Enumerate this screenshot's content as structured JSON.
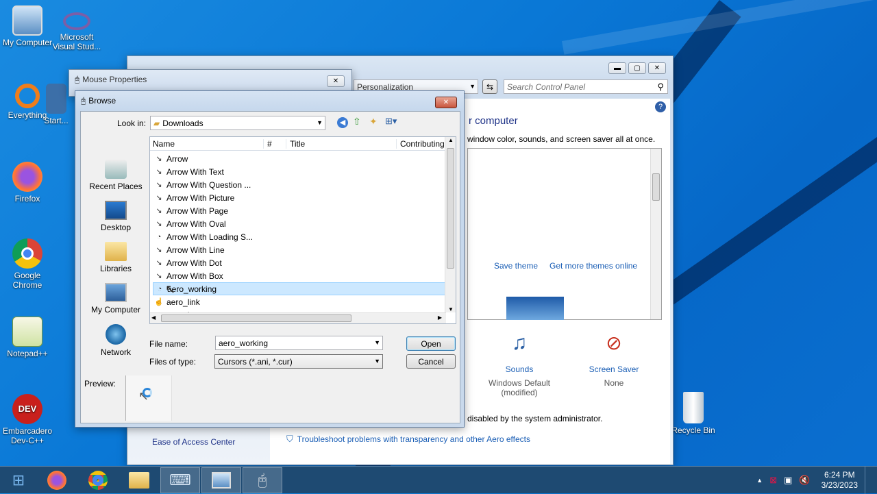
{
  "desktop": {
    "icons": [
      {
        "label": "My Computer"
      },
      {
        "label": "Microsoft Visual Stud..."
      },
      {
        "label": "Everything"
      },
      {
        "label": "Start..."
      },
      {
        "label": "Firefox"
      },
      {
        "label": "Google Chrome"
      },
      {
        "label": "Notepad++"
      },
      {
        "label": "Embarcadero Dev-C++"
      },
      {
        "label": "Recycle Bin"
      }
    ]
  },
  "control_panel": {
    "address": "Personalization",
    "search_placeholder": "Search Control Panel",
    "heading": "r computer",
    "subtext": "window color, sounds, and screen saver all at once.",
    "save_theme": "Save theme",
    "more_themes": "Get more themes online",
    "sounds_label": "Sounds",
    "sounds_value": "Windows Default",
    "sounds_value2": "(modified)",
    "screensaver_label": "Screen Saver",
    "screensaver_value": "None",
    "disabled_note": "disabled by the system administrator.",
    "ease_of_access": "Ease of Access Center",
    "troubleshoot": "Troubleshoot problems with transparency and other Aero effects"
  },
  "mouse_props": {
    "title": "Mouse Properties"
  },
  "browse": {
    "title": "Browse",
    "look_in_label": "Look in:",
    "look_in_value": "Downloads",
    "places": [
      "Recent Places",
      "Desktop",
      "Libraries",
      "My Computer",
      "Network"
    ],
    "columns": [
      "Name",
      "#",
      "Title",
      "Contributing"
    ],
    "files": [
      "Arrow",
      "Arrow With Text",
      "Arrow With Question ...",
      "Arrow With Picture",
      "Arrow With Page",
      "Arrow With Oval",
      "Arrow With Loading S...",
      "Arrow With Line",
      "Arrow With Dot",
      "Arrow With Box",
      "aero_working",
      "aero_link",
      "aero_busy"
    ],
    "selected_index": 10,
    "file_name_label": "File name:",
    "file_name_value": "aero_working",
    "file_type_label": "Files of type:",
    "file_type_value": "Cursors (*.ani, *.cur)",
    "open": "Open",
    "cancel": "Cancel",
    "preview_label": "Preview:"
  },
  "taskbar": {
    "time": "6:24 PM",
    "date": "3/23/2023"
  }
}
